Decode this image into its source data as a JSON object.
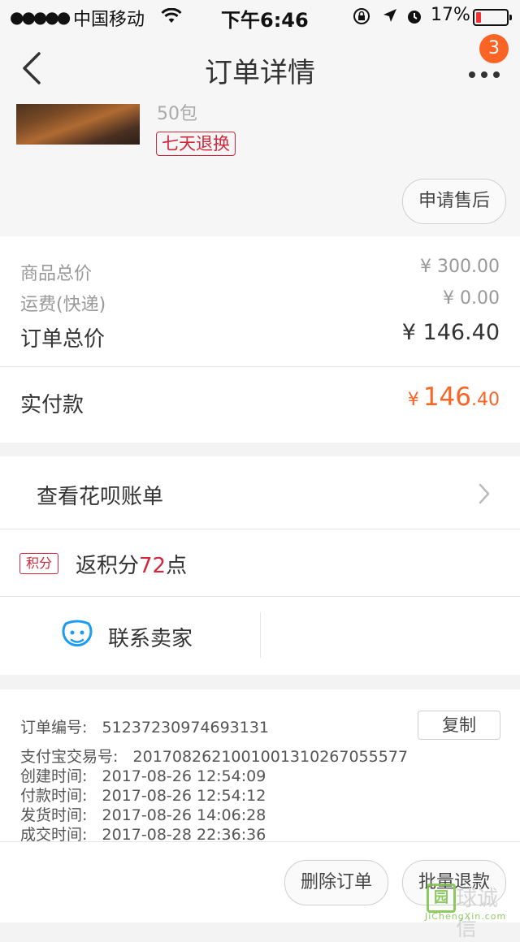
{
  "status_bar": {
    "signal": "●●●●●",
    "carrier": "中国移动",
    "time": "下午6:46",
    "battery": "17%",
    "battery_level": 0.17
  },
  "nav": {
    "title": "订单详情",
    "badge_count": "3"
  },
  "product": {
    "quantity_text": "50包",
    "tag": "七天退换",
    "after_sale_button": "申请售后"
  },
  "price": {
    "goods_total_label": "商品总价",
    "goods_total_value": "¥ 300.00",
    "shipping_label": "运费(快递)",
    "shipping_value": "¥ 0.00",
    "order_total_label": "订单总价",
    "order_total_value": "¥ 146.40",
    "paid_label": "实付款",
    "paid_currency": "¥",
    "paid_integer": "146",
    "paid_decimal": ".40"
  },
  "actions": {
    "huabei": "查看花呗账单",
    "points_badge": "积分",
    "points_prefix": "返积分",
    "points_num": "72",
    "points_suffix": "点",
    "contact": "联系卖家"
  },
  "order_info": {
    "order_no": "订单编号:   51237230974693131",
    "alipay_no": "支付宝交易号:   2017082621001001310267055577",
    "created": "创建时间:   2017-08-26 12:54:09",
    "paid": "付款时间:   2017-08-26 12:54:12",
    "shipped": "发货时间:   2017-08-26 14:06:28",
    "completed": "成交时间:   2017-08-28 22:36:36",
    "copy_button": "复制",
    "delete_button": "删除订单",
    "refund_button": "批量退款"
  },
  "watermark": {
    "box": "园",
    "name": "球诚信",
    "url": "JiChengXin.com"
  },
  "colors": {
    "accent": "#fb6424",
    "tag_red": "#d2273c",
    "watermark_green": "#7bc144"
  }
}
